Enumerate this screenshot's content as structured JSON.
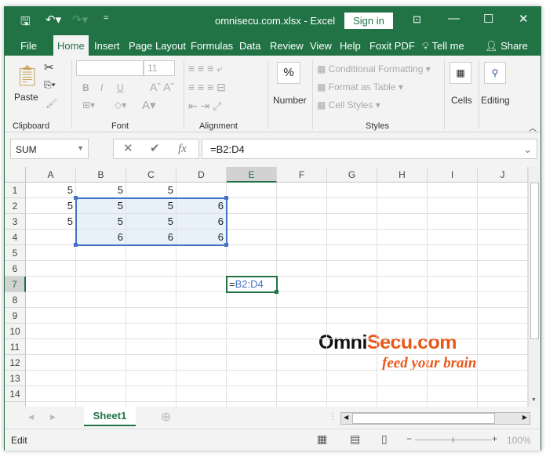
{
  "title": {
    "file": "omnisecu.com.xlsx  -  Excel",
    "signin": "Sign in"
  },
  "tabs": [
    "File",
    "Home",
    "Insert",
    "Page Layout",
    "Formulas",
    "Data",
    "Review",
    "View",
    "Help",
    "Foxit PDF",
    "Tell me",
    "Share"
  ],
  "ribbon": {
    "paste": "Paste",
    "font_size": "11",
    "bold": "B",
    "italic": "I",
    "underline": "U",
    "number": "Number",
    "percent": "%",
    "cond": "Conditional Formatting",
    "table": "Format as Table",
    "styles": "Cell Styles",
    "cells": "Cells",
    "editing": "Editing",
    "groups": {
      "clipboard": "Clipboard",
      "font": "Font",
      "alignment": "Alignment",
      "styles": "Styles"
    }
  },
  "formula_bar": {
    "name_box": "SUM",
    "formula": "=B2:D4",
    "fx": "fx"
  },
  "columns": [
    "A",
    "B",
    "C",
    "D",
    "E",
    "F",
    "G",
    "H",
    "I",
    "J"
  ],
  "rows": [
    "1",
    "2",
    "3",
    "4",
    "5",
    "6",
    "7",
    "8",
    "9",
    "10",
    "11",
    "12",
    "13",
    "14"
  ],
  "cells": {
    "A1": "5",
    "B1": "5",
    "C1": "5",
    "A2": "5",
    "B2": "5",
    "C2": "5",
    "D2": "6",
    "A3": "5",
    "B3": "5",
    "C3": "5",
    "D3": "6",
    "B4": "6",
    "C4": "6",
    "D4": "6"
  },
  "active_cell": {
    "ref": "E7",
    "eq": "=",
    "range": "B2:D4"
  },
  "watermark": {
    "brand": "OmniSecu.com",
    "tagline": "feed your brain"
  },
  "sheet_tab": "Sheet1",
  "status": {
    "mode": "Edit",
    "zoom": "100%"
  },
  "colors": {
    "accent": "#217346",
    "range": "#4472c4"
  }
}
